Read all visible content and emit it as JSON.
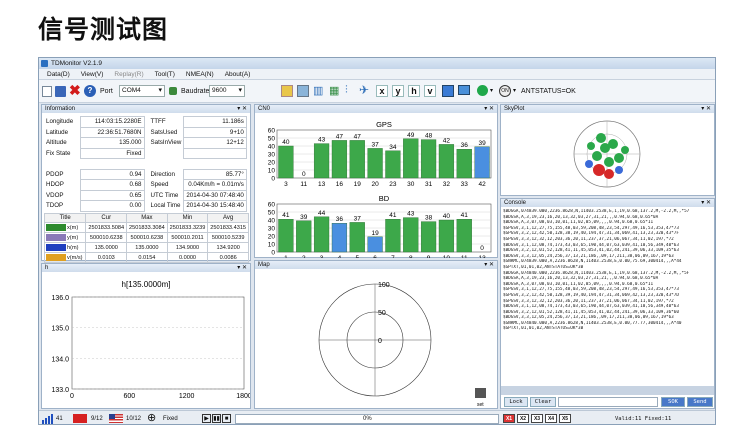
{
  "heading": "信号测试图",
  "window": {
    "title": "TDMonitor V2.1.9"
  },
  "menu": [
    {
      "label": "Data(D)",
      "disabled": false
    },
    {
      "label": "View(V)",
      "disabled": false
    },
    {
      "label": "Replay(R)",
      "disabled": true
    },
    {
      "label": "Tool(T)",
      "disabled": false
    },
    {
      "label": "NMEA(N)",
      "disabled": false
    },
    {
      "label": "About(A)",
      "disabled": false
    }
  ],
  "toolbar": {
    "port_label": "Port",
    "port_value": "COM4",
    "baud_label": "Baudrate",
    "baud_value": "9600",
    "letters": [
      "x",
      "y",
      "h",
      "v"
    ],
    "ant_status": "ANTSTATUS=OK"
  },
  "info": {
    "title": "Information",
    "left": [
      {
        "label": "Longitude",
        "value": "114:03:15.2280E"
      },
      {
        "label": "Latitude",
        "value": "22:36:51.7680N"
      },
      {
        "label": "Altitude",
        "value": "135.000"
      },
      {
        "label": "Fix State",
        "value": "Fixed"
      },
      {
        "label": "",
        "value": ""
      },
      {
        "label": "PDOP",
        "value": "0.94"
      },
      {
        "label": "HDOP",
        "value": "0.68"
      },
      {
        "label": "VDOP",
        "value": "0.65"
      },
      {
        "label": "TDOP",
        "value": "0.00"
      }
    ],
    "right": [
      {
        "label": "TTFF",
        "value": "11.186s"
      },
      {
        "label": "SatsUsed",
        "value": "9+10"
      },
      {
        "label": "SatsInView",
        "value": "12+12"
      },
      {
        "label": "",
        "value": ""
      },
      {
        "label": "",
        "value": ""
      },
      {
        "label": "Direction",
        "value": "85.77°"
      },
      {
        "label": "Speed",
        "value": "0.04Km/h = 0.01m/s"
      },
      {
        "label": "UTC Time",
        "value": "2014-04-30 07:48:40"
      },
      {
        "label": "Local Time",
        "value": "2014-04-30 15:48:40"
      }
    ]
  },
  "stats": {
    "headers": [
      "Title",
      "Cur",
      "Max",
      "Min",
      "Avg"
    ],
    "rows": [
      {
        "name": "x(m)",
        "color": "#2e8b2e",
        "cur": "2501833.5084",
        "max": "2501833.3084",
        "min": "2501833.3239",
        "avg": "2501833.4315"
      },
      {
        "name": "y(m)",
        "color": "#8a7ab8",
        "cur": "500010.6238",
        "max": "500010.6238",
        "min": "500010.2011",
        "avg": "500010.5239"
      },
      {
        "name": "h(m)",
        "color": "#1f3fbf",
        "cur": "135.0000",
        "max": "135.0000",
        "min": "134.9000",
        "avg": "134.9200"
      },
      {
        "name": "v(m/s)",
        "color": "#e0a020",
        "cur": "0.0103",
        "max": "0.0154",
        "min": "0.0000",
        "avg": "0.0086"
      }
    ]
  },
  "hplot": {
    "tab": "h",
    "title": "h[135.0000m]",
    "y_ticks": [
      "136.0",
      "135.0",
      "134.0",
      "133.0"
    ],
    "x_ticks": [
      "0",
      "600",
      "1200",
      "1800"
    ]
  },
  "cn0": {
    "tab": "CN0",
    "gps": {
      "title": "GPS",
      "y_ticks": [
        "60",
        "50",
        "40",
        "30",
        "20",
        "10",
        "0"
      ],
      "bars": [
        {
          "id": "3",
          "v": 40,
          "used": true
        },
        {
          "id": "11",
          "v": 0,
          "used": true
        },
        {
          "id": "13",
          "v": 43,
          "used": true
        },
        {
          "id": "16",
          "v": 47,
          "used": true
        },
        {
          "id": "19",
          "v": 47,
          "used": true
        },
        {
          "id": "20",
          "v": 37,
          "used": true
        },
        {
          "id": "23",
          "v": 34,
          "used": true
        },
        {
          "id": "30",
          "v": 49,
          "used": true
        },
        {
          "id": "31",
          "v": 48,
          "used": true
        },
        {
          "id": "32",
          "v": 42,
          "used": true
        },
        {
          "id": "33",
          "v": 36,
          "used": true
        },
        {
          "id": "42",
          "v": 39,
          "used": false
        }
      ]
    },
    "bd": {
      "title": "BD",
      "y_ticks": [
        "60",
        "50",
        "40",
        "30",
        "20",
        "10",
        "0"
      ],
      "bars": [
        {
          "id": "1",
          "v": 41,
          "used": true
        },
        {
          "id": "2",
          "v": 39,
          "used": true
        },
        {
          "id": "3",
          "v": 44,
          "used": true
        },
        {
          "id": "4",
          "v": 36,
          "used": false
        },
        {
          "id": "5",
          "v": 37,
          "used": true
        },
        {
          "id": "6",
          "v": 19,
          "used": false
        },
        {
          "id": "7",
          "v": 41,
          "used": true
        },
        {
          "id": "8",
          "v": 43,
          "used": true
        },
        {
          "id": "9",
          "v": 38,
          "used": true
        },
        {
          "id": "10",
          "v": 40,
          "used": true
        },
        {
          "id": "11",
          "v": 41,
          "used": true
        },
        {
          "id": "13",
          "v": 0,
          "used": false
        }
      ]
    }
  },
  "map": {
    "tab": "Map",
    "labels": [
      "100",
      "50",
      "0"
    ],
    "set_label": "set"
  },
  "skyplot": {
    "tab": "SkyPlot"
  },
  "console": {
    "tab": "Console",
    "lines": [
      "$BDGGA,074839.000,2236.8628,N,11403.2538,E,1,19,0.68,137.2,M,-2.2,M,,*57",
      "$BDGSA,A,3,19,23,16,20,13,32,03,27,31,21,,,0.94,0.68,0.65*0A",
      "$BDGSA,A,3,07,08,03,10,01,11,02,05,09,,,,0.94,0.68,0.65*11",
      "$GPGSV,3,1,12,27,75,155,48,03,59,208,48,23,54,297,49,16,53,353,47*73",
      "$GPGSV,3,2,12,42,50,128,38,19,40,194,47,31,34,069,41,13,23,320,43*7F",
      "$GPGSV,3,3,12,32,12,203,36,20,11,237,37,21,06,067,34,11,02,197,*72",
      "$BDGSV,3,1,12,08,74,173,43,03,65,190,44,07,63,039,41,10,56,349,40*63",
      "$BDGSV,3,2,12,01,52,128,41,11,45,053,41,02,44,241,39,06,33,109,35*63",
      "$BDGSV,3,3,12,05,24,256,37,13,21,186,,09,17,211,38,06,09,167,19*63",
      "$GNRMC,074839.000,A,2236.8628,N,11403.2538,E,0.00,75.69,300414,,,A*44",
      "$GPTXT,01,01,02,ANTSTATUS=OK*3B",
      "$BDGGA,074840.000,2236.8628,N,11403.2538,E,1,19,0.68,137.2,M,-2.2,M,,*5F",
      "$BDGSA,A,3,19,23,16,20,13,32,03,27,31,21,,,0.94,0.68,0.65*0A",
      "$BDGSA,A,3,07,08,03,10,01,11,02,05,09,,,,0.94,0.68,0.65*11",
      "$GPGSV,3,1,12,27,75,155,48,03,59,208,48,23,54,297,49,16,53,353,47*73",
      "$GPGSV,3,2,12,42,50,128,39,19,40,194,47,31,34,069,42,13,23,320,43*7D",
      "$GPGSV,3,3,12,32,12,203,36,20,11,237,37,21,06,067,34,11,02,197,*72",
      "$BDGSV,3,1,12,08,74,173,43,03,65,190,44,07,63,039,41,10,56,349,40*63",
      "$BDGSV,3,2,12,01,52,128,41,11,45,053,41,02,44,241,39,06,33,109,36*60",
      "$BDGSV,3,3,12,05,24,256,37,13,21,186,,09,17,211,38,06,09,167,19*63",
      "$GNRMC,074840.000,A,2236.8628,N,11403.2538,E,0.00,77.77,300414,,,A*40",
      "$GPTXT,01,01,02,ANTSTATUS=OK*3B"
    ],
    "lock": "Lock",
    "clear": "Clear",
    "ok": "SOK",
    "send": "Send",
    "tabs": [
      "X1",
      "X2",
      "X3",
      "X4",
      "X5"
    ],
    "valid": "Valid:11 Fixed:11"
  },
  "status": {
    "sig_count": "41",
    "cn_count": "9/12",
    "us_count": "10/12",
    "fix": "Fixed",
    "progress": "0%"
  }
}
